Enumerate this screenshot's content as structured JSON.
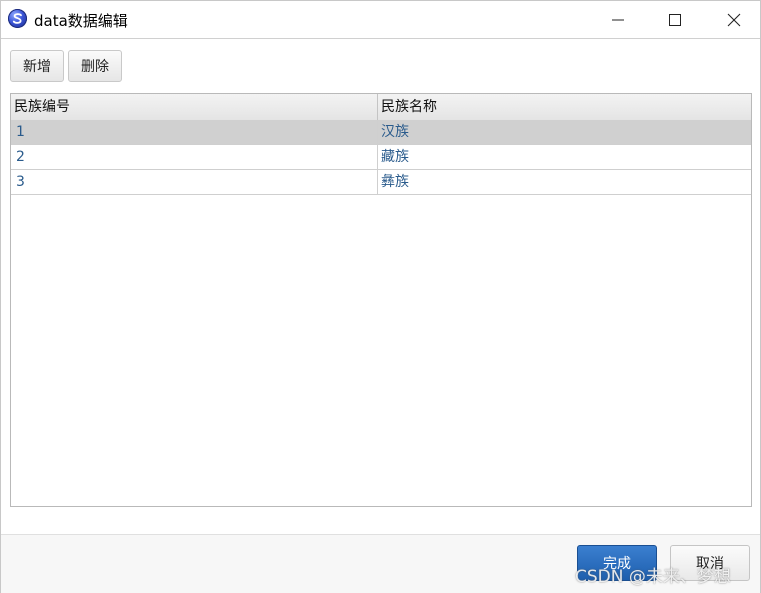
{
  "window": {
    "title": "data数据编辑",
    "icon": "app-logo-icon"
  },
  "toolbar": {
    "add_label": "新增",
    "delete_label": "删除"
  },
  "table": {
    "columns": [
      "民族编号",
      "民族名称"
    ],
    "rows": [
      {
        "id": "1",
        "name": "汉族",
        "selected": true
      },
      {
        "id": "2",
        "name": "藏族",
        "selected": false
      },
      {
        "id": "3",
        "name": "彝族",
        "selected": false
      }
    ]
  },
  "footer": {
    "done_label": "完成",
    "cancel_label": "取消"
  },
  "watermark": "CSDN @未来、梦想",
  "colors": {
    "accent": "#1e5fae",
    "cell_text": "#2a5b8c",
    "selected_row": "#d0d0d0"
  }
}
